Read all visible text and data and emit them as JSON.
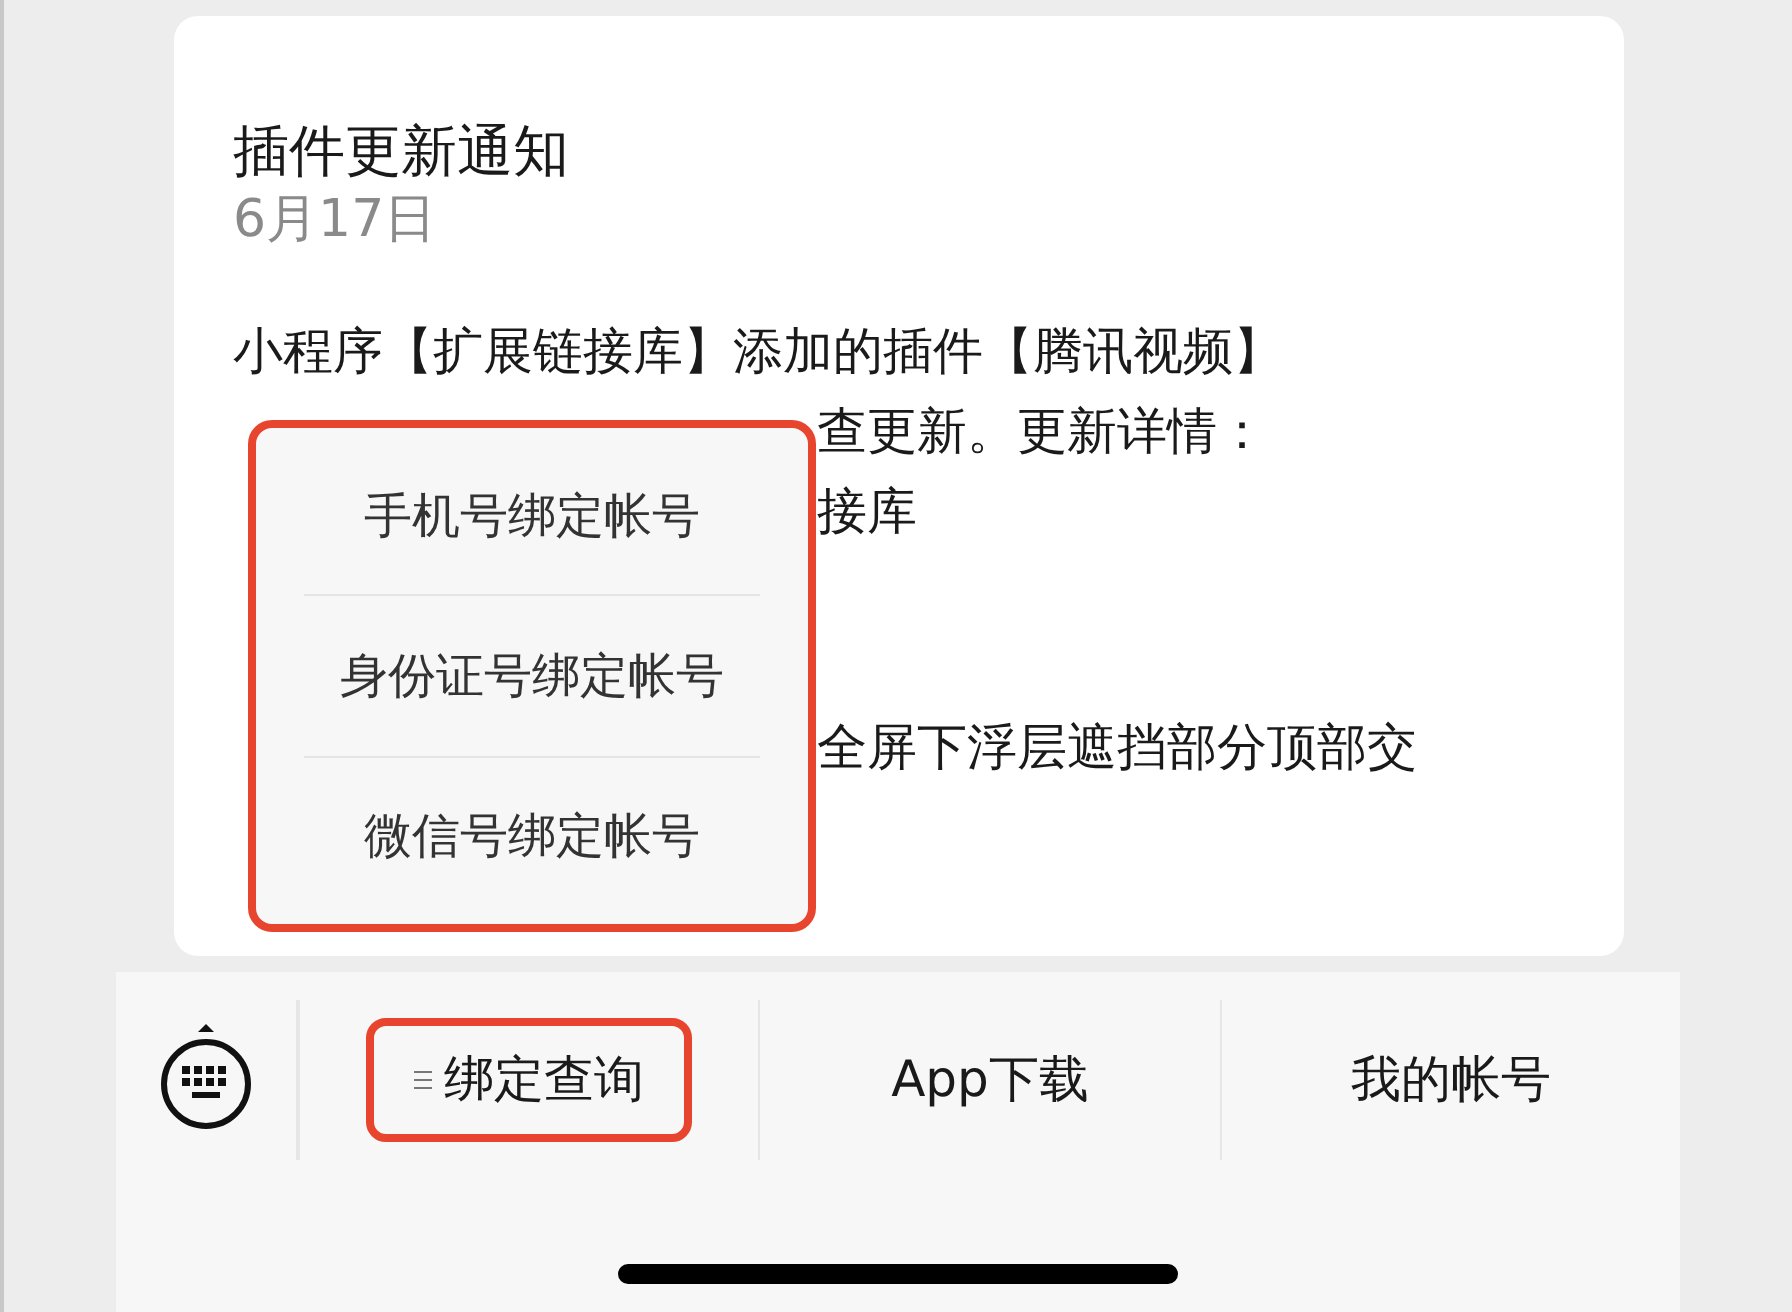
{
  "message": {
    "title": "插件更新通知",
    "date": "6月17日",
    "lines": [
      {
        "kind": "full",
        "text": "小程序【扩展链接库】添加的插件【腾讯视频】"
      },
      {
        "kind": "covered",
        "text": "查更新。更新详情："
      },
      {
        "kind": "covered",
        "text": "接库"
      },
      {
        "kind": "covered_gap",
        "text": "全屏下浮层遮挡部分顶部交"
      }
    ]
  },
  "popup_menu": {
    "highlighted": true,
    "items": [
      "手机号绑定帐号",
      "身份证号绑定帐号",
      "微信号绑定帐号"
    ]
  },
  "menu_bar": {
    "items": [
      {
        "label": "绑定查询",
        "has_menu": true,
        "highlighted": true
      },
      {
        "label": "App下载",
        "has_menu": false,
        "highlighted": false
      },
      {
        "label": "我的帐号",
        "has_menu": false,
        "highlighted": false
      }
    ]
  }
}
